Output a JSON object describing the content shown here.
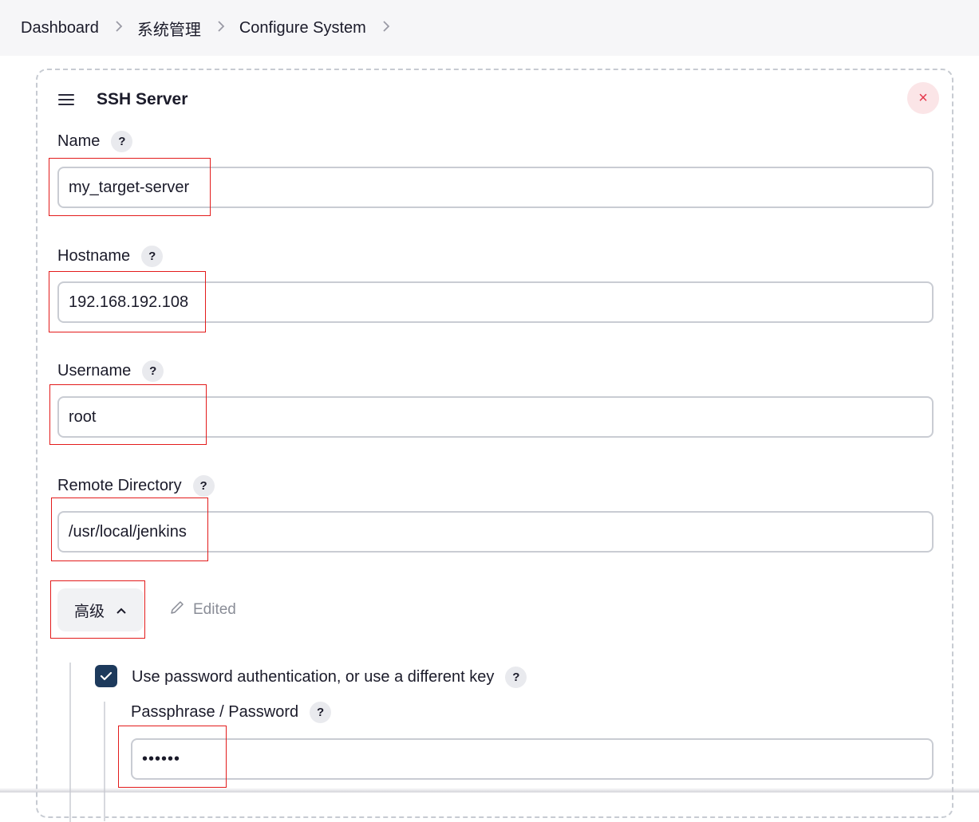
{
  "breadcrumb": {
    "items": [
      "Dashboard",
      "系统管理",
      "Configure System"
    ],
    "separator": ">"
  },
  "section": {
    "title": "SSH Server",
    "close_symbol": "×"
  },
  "fields": {
    "name": {
      "label": "Name",
      "value": "my_target-server"
    },
    "hostname": {
      "label": "Hostname",
      "value": "192.168.192.108"
    },
    "username": {
      "label": "Username",
      "value": "root"
    },
    "remote_directory": {
      "label": "Remote Directory",
      "value": "/usr/local/jenkins"
    }
  },
  "help_symbol": "?",
  "advanced": {
    "label": "高级",
    "chevron": "^",
    "edited_label": "Edited"
  },
  "password_auth": {
    "checked": true,
    "label": "Use password authentication, or use a different key",
    "passphrase_label": "Passphrase / Password",
    "passphrase_value": "••••••"
  },
  "colors": {
    "highlight_box": "#e31b1b",
    "checkbox": "#1d3a5c",
    "close_button": "#e5364a"
  }
}
